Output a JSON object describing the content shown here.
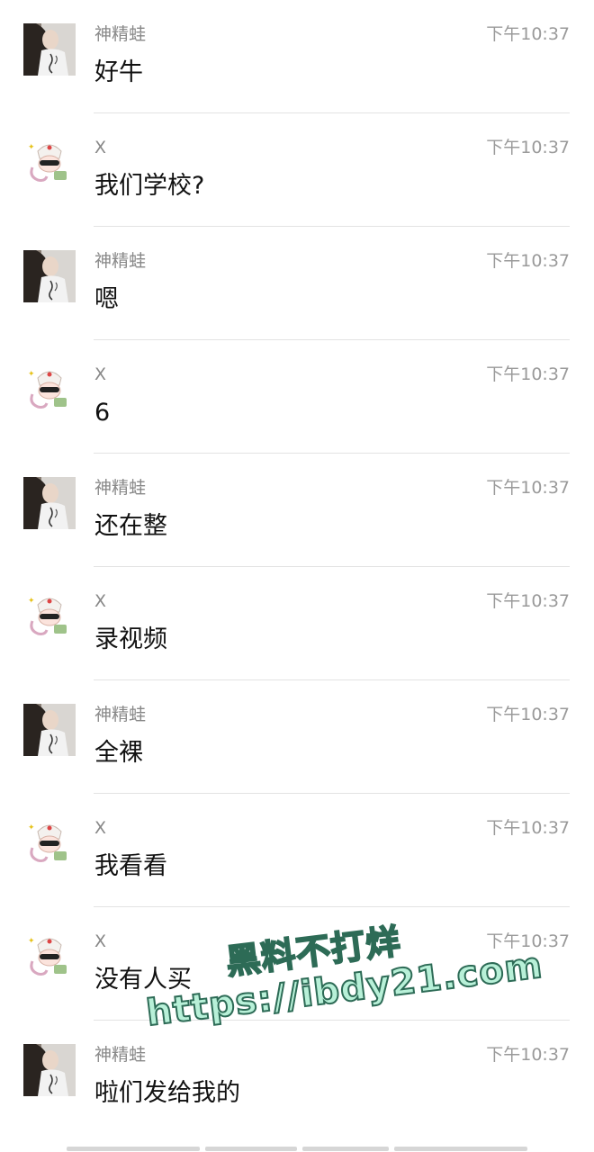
{
  "chat": {
    "messages": [
      {
        "sender": "神精蛙",
        "avatar": "photo-avatar-icon",
        "time": "下午10:37",
        "text": "好牛"
      },
      {
        "sender": "X",
        "avatar": "cartoon-avatar-icon",
        "time": "下午10:37",
        "text": "我们学校?"
      },
      {
        "sender": "神精蛙",
        "avatar": "photo-avatar-icon",
        "time": "下午10:37",
        "text": "嗯"
      },
      {
        "sender": "X",
        "avatar": "cartoon-avatar-icon",
        "time": "下午10:37",
        "text": "6"
      },
      {
        "sender": "神精蛙",
        "avatar": "photo-avatar-icon",
        "time": "下午10:37",
        "text": "还在整"
      },
      {
        "sender": "X",
        "avatar": "cartoon-avatar-icon",
        "time": "下午10:37",
        "text": "录视频"
      },
      {
        "sender": "神精蛙",
        "avatar": "photo-avatar-icon",
        "time": "下午10:37",
        "text": "全裸"
      },
      {
        "sender": "X",
        "avatar": "cartoon-avatar-icon",
        "time": "下午10:37",
        "text": "我看看"
      },
      {
        "sender": "X",
        "avatar": "cartoon-avatar-icon",
        "time": "下午10:37",
        "text": "没有人买"
      },
      {
        "sender": "神精蛙",
        "avatar": "photo-avatar-icon",
        "time": "下午10:37",
        "text": "啦们发给我的"
      }
    ]
  },
  "watermark": {
    "line1": "黑料不打烊",
    "line2": "https://ibdy21.com"
  },
  "colors": {
    "name": "#888888",
    "time": "#9a9a9a",
    "message": "#111111",
    "divider": "#e3e3e3",
    "watermark_fill": "#b8f0d8",
    "watermark_stroke": "#2d6b56"
  }
}
